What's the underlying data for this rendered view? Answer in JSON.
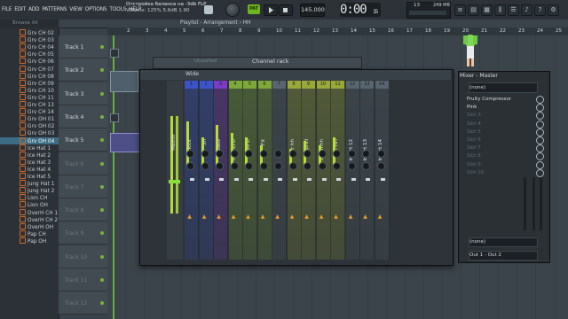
{
  "menu": [
    "FILE",
    "EDIT",
    "ADD",
    "PATTERNS",
    "VIEW",
    "OPTIONS",
    "TOOLS",
    "HELP"
  ],
  "hint": {
    "title": "Отстройка баланса на -3db FLP",
    "volume": "Volume: 125%  5.6dB  1.90"
  },
  "transport": {
    "pat_label": "PAT",
    "tempo": "145.000",
    "time": "0:00",
    "time_sub": "15"
  },
  "cpu": {
    "num": "13",
    "mem": "249 MB",
    "sub": "0"
  },
  "browser": {
    "header": "Browse  All",
    "items": [
      "Grv CH 02",
      "Grv CH 03",
      "Grv CH 04",
      "Grv CH 05",
      "Grv CH 06",
      "Grv CH 07",
      "Grv CH 08",
      "Grv CH 09",
      "Grv CH 10",
      "Grv CH 11",
      "Grv CH 13",
      "Grv CH 14",
      "Grv OH 01",
      "Grv OH 02",
      "Grv OH 03",
      "Grv OH 04",
      "Ice Hat 1",
      "Ice Hat 2",
      "Ice Hat 3",
      "Ice Hat 4",
      "Ice Hat 5",
      "Jung Hat 1",
      "Jung Hat 2",
      "Lion CH",
      "Lion OH",
      "OverH CH 1",
      "OverH CH 2",
      "OverH OH",
      "Pap CH",
      "Pap OH"
    ],
    "selected_index": 15
  },
  "playlist": {
    "title": "Playlist - Arrangement › HH",
    "ruler": [
      "2",
      "3",
      "4",
      "5",
      "6",
      "7",
      "8",
      "9",
      "10",
      "11",
      "12",
      "13",
      "14",
      "15",
      "16",
      "17",
      "18",
      "19",
      "20",
      "21",
      "22",
      "23",
      "24",
      "25"
    ],
    "tracks": [
      "Track 1",
      "Track 2",
      "Track 3",
      "Track 4",
      "Track 5",
      "Track 6",
      "Track 7",
      "Track 8",
      "Track 9",
      "Track 10",
      "Track 11",
      "Track 12"
    ]
  },
  "channel_rack": {
    "title": "Channel rack",
    "filter": "Unsorted"
  },
  "mixer": {
    "preset": "Wide",
    "master_label": "Master",
    "strips": [
      {
        "num": "1",
        "name": "Kick",
        "color": "#3b55c9"
      },
      {
        "num": "2",
        "name": "Sn",
        "color": "#3b55c9"
      },
      {
        "num": "3",
        "name": "Bass",
        "color": "#7b3bc2"
      },
      {
        "num": "4",
        "name": "Mod LFO",
        "color": "#7ea839"
      },
      {
        "num": "5",
        "name": "Mod D",
        "color": "#7ea839"
      },
      {
        "num": "6",
        "name": "FX",
        "color": "#7ea839"
      },
      {
        "num": "7",
        "name": "",
        "color": "#58656e"
      },
      {
        "num": "8",
        "name": "Lr hh",
        "color": "#9aa83a"
      },
      {
        "num": "9",
        "name": "OpHH",
        "color": "#9aa83a"
      },
      {
        "num": "10",
        "name": "Synth hh",
        "color": "#9aa83a"
      },
      {
        "num": "11",
        "name": "ALL HH",
        "color": "#9aa83a"
      },
      {
        "num": "12",
        "name": "Insert 12",
        "color": "#58656e"
      },
      {
        "num": "13",
        "name": "Insert 13",
        "color": "#58656e"
      },
      {
        "num": "14",
        "name": "Insert 14",
        "color": "#58656e"
      }
    ],
    "panel": {
      "title": "Mixer - Master",
      "input": "(none)",
      "slots": [
        "Fruity Compressor",
        "Pink",
        "Slot 3",
        "Slot 4",
        "Slot 5",
        "Slot 6",
        "Slot 7",
        "Slot 8",
        "Slot 9",
        "Slot 10"
      ],
      "sidechain": "(none)",
      "output": "Out 1 - Out 2"
    }
  }
}
